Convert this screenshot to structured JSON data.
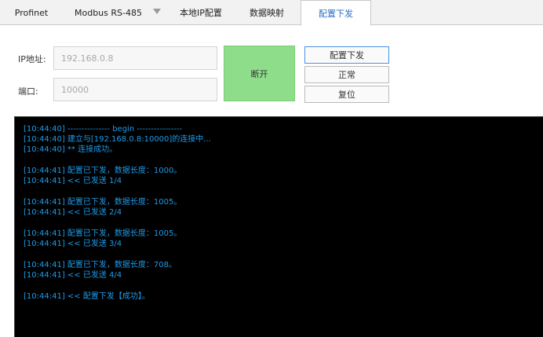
{
  "tabs": [
    {
      "label": "Profinet"
    },
    {
      "label": "Modbus RS-485"
    },
    {
      "label": "本地IP配置"
    },
    {
      "label": "数据映射"
    },
    {
      "label": "配置下发"
    }
  ],
  "active_tab": "配置下发",
  "form": {
    "ip_label": "IP地址:",
    "ip_value": "192.168.0.8",
    "port_label": "端口:",
    "port_value": "10000"
  },
  "buttons": {
    "disconnect": "断开",
    "deploy": "配置下发",
    "normal": "正常",
    "reset": "复位"
  },
  "colors": {
    "disconnect_bg": "#8ddd8b",
    "console_bg": "#000000",
    "console_text": "#1e9be9",
    "active_tab_text": "#2b6fc7"
  },
  "log": [
    "[10:44:40] --------------- begin ----------------",
    "[10:44:40] 建立与[192.168.0.8:10000]的连接中...",
    "[10:44:40] ** 连接成功。",
    "",
    "[10:44:41] 配置已下发，数据长度：1000。",
    "[10:44:41] << 已发送 1/4",
    "",
    "[10:44:41] 配置已下发，数据长度：1005。",
    "[10:44:41] << 已发送 2/4",
    "",
    "[10:44:41] 配置已下发，数据长度：1005。",
    "[10:44:41] << 已发送 3/4",
    "",
    "[10:44:41] 配置已下发，数据长度：708。",
    "[10:44:41] << 已发送 4/4",
    "",
    "[10:44:41] << 配置下发【成功】。"
  ]
}
